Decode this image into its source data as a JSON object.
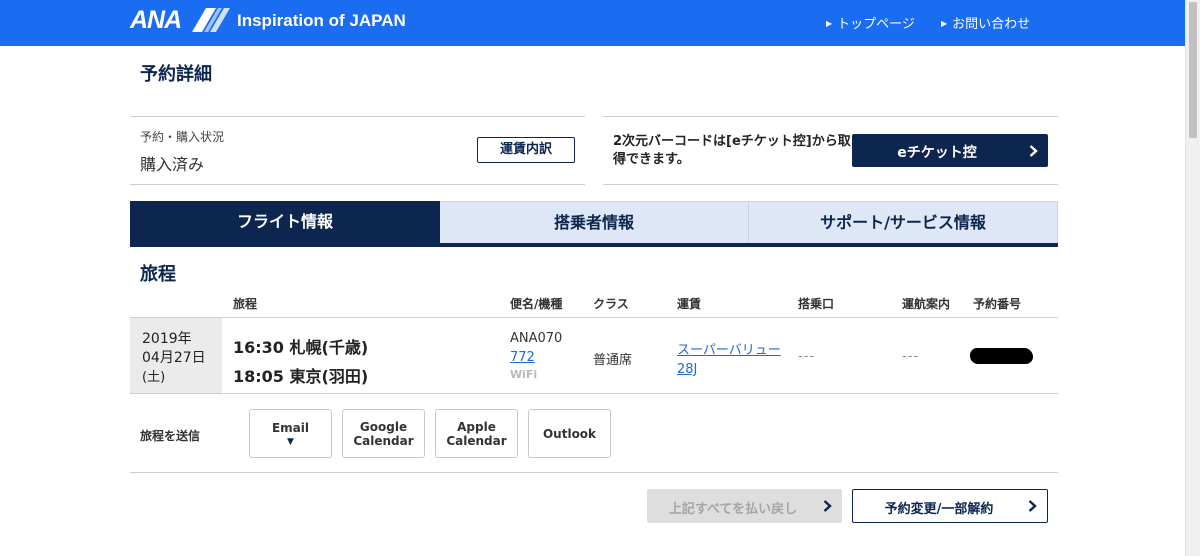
{
  "header": {
    "logo": "ANA",
    "tagline": "Inspiration of JAPAN",
    "nav": [
      "トップページ",
      "お問い合わせ"
    ],
    "background": "#1a6cf0"
  },
  "page": {
    "title": "予約詳細"
  },
  "status": {
    "label": "予約・購入状況",
    "value": "購入済み",
    "fare_button": "運賃内訳"
  },
  "eticket": {
    "note": "2次元バーコードは[eチケット控]から取得できます。",
    "button": "eチケット控"
  },
  "tabs": [
    {
      "label": "フライト情報",
      "active": true
    },
    {
      "label": "搭乗者情報",
      "active": false
    },
    {
      "label": "サポート/サービス情報",
      "active": false
    }
  ],
  "itinerary": {
    "title": "旅程",
    "columns": [
      "旅程",
      "便名/機種",
      "クラス",
      "運賃",
      "搭乗口",
      "運航案内",
      "予約番号"
    ],
    "row": {
      "date_line1": "2019年",
      "date_line2": "04月27日",
      "date_line3": "(土)",
      "depart": "16:30 札幌(千歳)",
      "arrive": "18:05 東京(羽田)",
      "flight_no": "ANA070",
      "aircraft": "772",
      "wifi": "WiFi",
      "class": "普通席",
      "fare_line1": "スーパーバリュー",
      "fare_line2": "28J",
      "gate": "---",
      "operation": "---"
    }
  },
  "send": {
    "label": "旅程を送信",
    "email": "Email",
    "google": [
      "Google",
      "Calendar"
    ],
    "apple": [
      "Apple",
      "Calendar"
    ],
    "outlook": "Outlook"
  },
  "actions": {
    "refund": "上記すべてを払い戻し",
    "change": "予約変更/一部解約"
  },
  "colors": {
    "navy": "#0d2650",
    "tab_inactive": "#dde7f5",
    "link": "#1c6ad4"
  }
}
